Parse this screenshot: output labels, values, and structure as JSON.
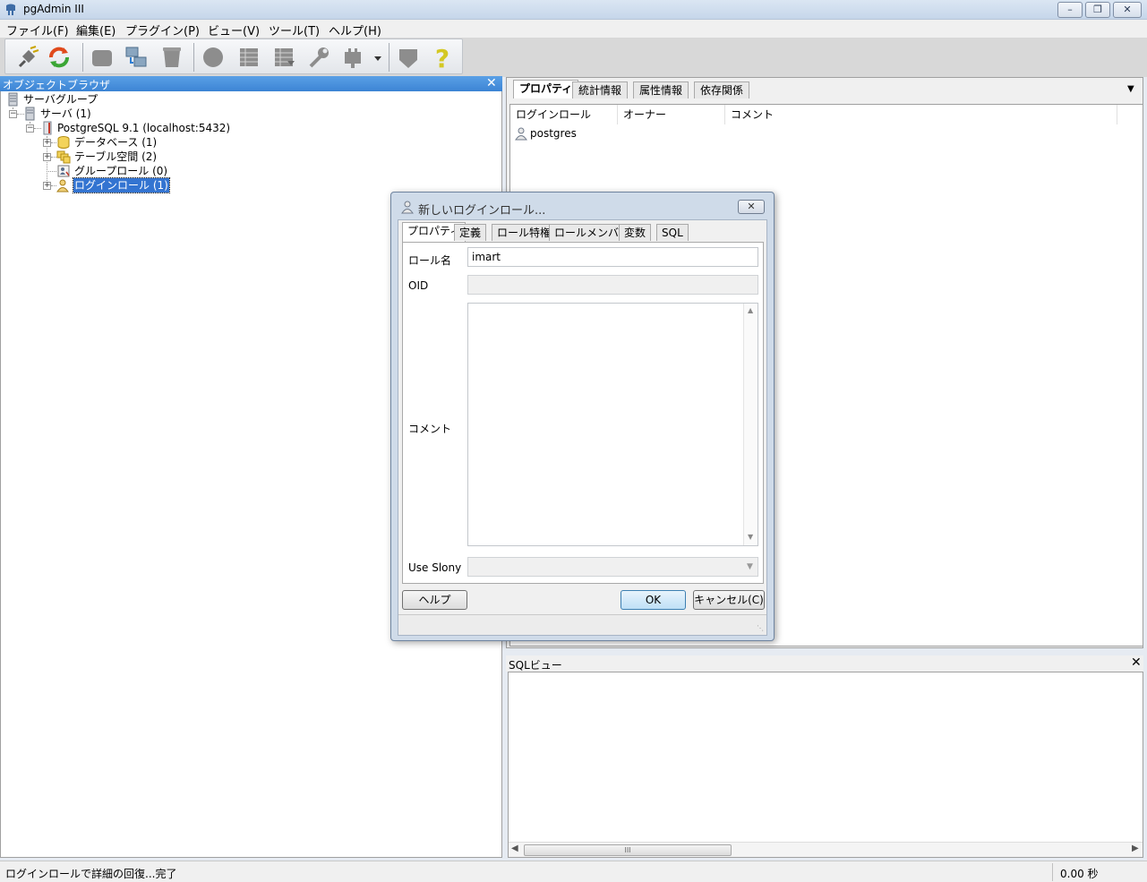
{
  "window": {
    "title": "pgAdmin III"
  },
  "menu": [
    "ファイル(F)",
    "編集(E)",
    "プラグイン(P)",
    "ビュー(V)",
    "ツール(T)",
    "ヘルプ(H)"
  ],
  "toolbar_icons": [
    "connect-plug-icon",
    "refresh-icon",
    "properties-icon",
    "create-icon",
    "drop-icon",
    "sql-icon",
    "view-data-icon",
    "filtered-view-icon",
    "maintenance-wrench-icon",
    "plugins-icon",
    "hint-icon",
    "help-icon"
  ],
  "browser": {
    "title": "オブジェクトブラウザ",
    "tree": {
      "server_groups": "サーバグループ",
      "servers": "サーバ (1)",
      "server": "PostgreSQL 9.1 (localhost:5432)",
      "databases": "データベース (1)",
      "tablespaces": "テーブル空間 (2)",
      "group_roles": "グループロール (0)",
      "login_roles": "ログインロール (1)"
    }
  },
  "right": {
    "tabs": [
      "プロパティ",
      "統計情報",
      "属性情報",
      "依存関係"
    ],
    "columns": [
      "ログインロール",
      "オーナー",
      "コメント"
    ],
    "rows": [
      {
        "name": "postgres",
        "owner": "",
        "comment": ""
      }
    ]
  },
  "sql_view": {
    "title": "SQLビュー",
    "scroll_grip": "III"
  },
  "status": {
    "message": "ログインロールで詳細の回復...完了",
    "time": "0.00 秒"
  },
  "dialog": {
    "title": "新しいログインロール...",
    "tabs": [
      "プロパティ",
      "定義",
      "ロール特権",
      "ロールメンバー",
      "変数",
      "SQL"
    ],
    "fields": {
      "role_name_label": "ロール名",
      "role_name_value": "imart",
      "oid_label": "OID",
      "oid_value": "",
      "comment_label": "コメント",
      "comment_value": "",
      "use_slony_label": "Use Slony",
      "use_slony_value": ""
    },
    "buttons": {
      "help": "ヘルプ",
      "ok": "OK",
      "cancel": "キャンセル(C)"
    }
  }
}
